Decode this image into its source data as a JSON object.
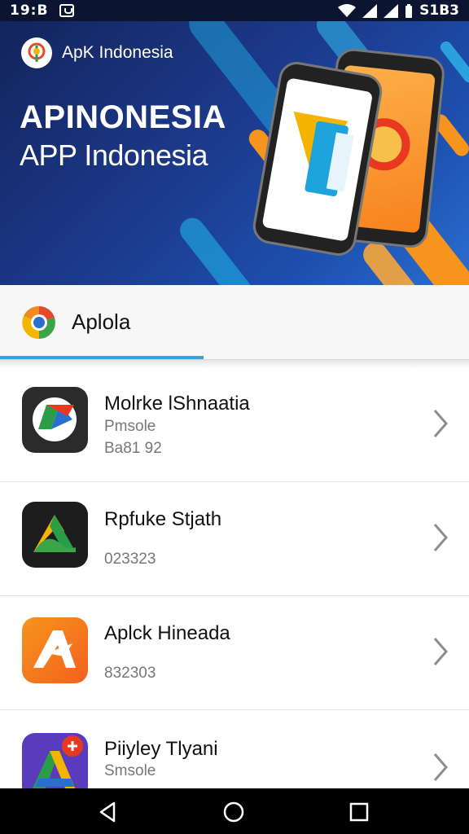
{
  "status_bar": {
    "time": "19:B",
    "battery_text": "S1B3",
    "icons": [
      "notification-icon",
      "wifi-icon",
      "signal-icon",
      "signal-icon",
      "battery-icon"
    ]
  },
  "banner": {
    "brand_label": "ApK Indonesia",
    "headline": "APINONESIA",
    "subline": "APP Indonesia",
    "colors": {
      "background": "#1c3a8c",
      "accent_orange": "#f7941d",
      "accent_cyan": "#1fa3dc"
    }
  },
  "section": {
    "title": "Aplola",
    "icon": "chrome-style-logo-icon",
    "underline_color": "#3ea0d9"
  },
  "apps": [
    {
      "name": "Molrke lShnaatia",
      "meta1": "Pmsole",
      "meta2": "Ba81 92",
      "icon": "drive-style-app-icon"
    },
    {
      "name": "Rpfuke Stjath",
      "meta1": "",
      "meta2": "023323",
      "icon": "green-a-app-icon"
    },
    {
      "name": "Aplck Hineada",
      "meta1": "",
      "meta2": "832303",
      "icon": "orange-a-app-icon"
    },
    {
      "name": "Piiyley Tlyani",
      "meta1": "Smsole",
      "meta2": "",
      "icon": "multicolor-a-app-icon"
    }
  ],
  "nav_bar": {
    "buttons": [
      "back-icon",
      "home-icon",
      "recents-icon"
    ]
  }
}
